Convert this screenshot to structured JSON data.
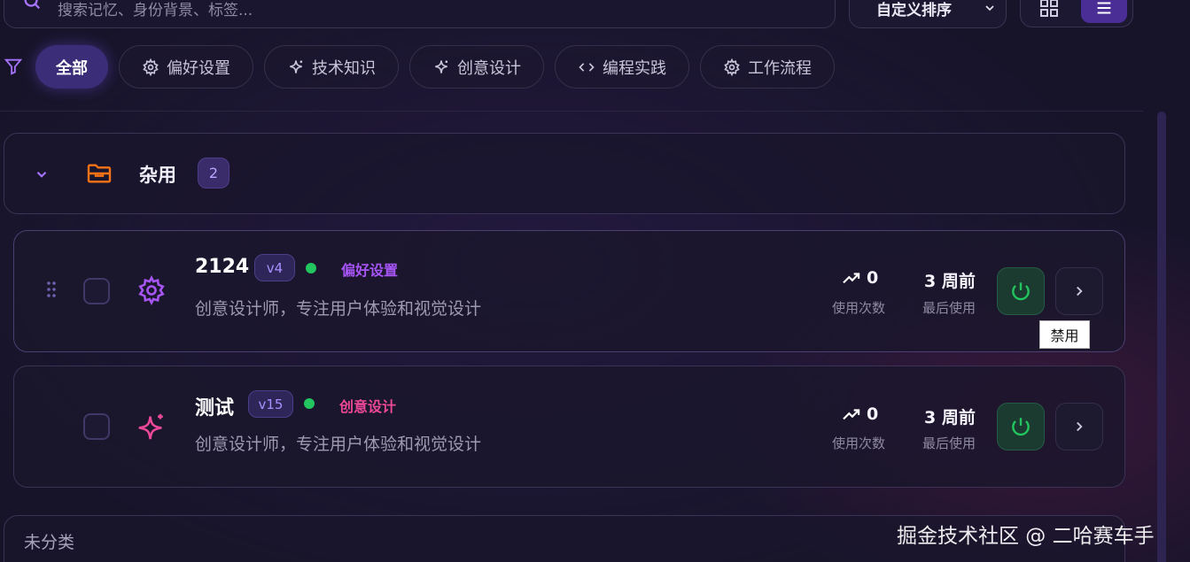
{
  "toolbar": {
    "search_placeholder": "搜索记忆、身份背景、标签...",
    "sort_label": "自定义排序"
  },
  "filters": [
    {
      "label": "全部",
      "active": true
    },
    {
      "label": "偏好设置",
      "icon": "gear-icon"
    },
    {
      "label": "技术知识",
      "icon": "sparkle-icon"
    },
    {
      "label": "创意设计",
      "icon": "sparkle-icon"
    },
    {
      "label": "编程实践",
      "icon": "code-icon"
    },
    {
      "label": "工作流程",
      "icon": "gear-icon"
    }
  ],
  "group": {
    "title": "杂用",
    "count": "2"
  },
  "items": [
    {
      "title": "2124",
      "version": "v4",
      "tag": "偏好设置",
      "tag_color": "#a855f7",
      "icon": "gear-icon",
      "description": "创意设计师，专注用户体验和视觉设计",
      "usage_count": "0",
      "usage_label": "使用次数",
      "last_used": "3 周前",
      "last_used_label": "最后使用"
    },
    {
      "title": "测试",
      "version": "v15",
      "tag": "创意设计",
      "tag_color": "#ec4899",
      "icon": "sparkle-icon",
      "description": "创意设计师，专注用户体验和视觉设计",
      "usage_count": "0",
      "usage_label": "使用次数",
      "last_used": "3 周前",
      "last_used_label": "最后使用"
    }
  ],
  "tooltip": "禁用",
  "uncategorized_label": "未分类",
  "watermark": "掘金技术社区 @ 二哈赛车手",
  "colors": {
    "accent": "#7c4dff",
    "active_dot": "#22c55e",
    "folder": "#f97316"
  }
}
